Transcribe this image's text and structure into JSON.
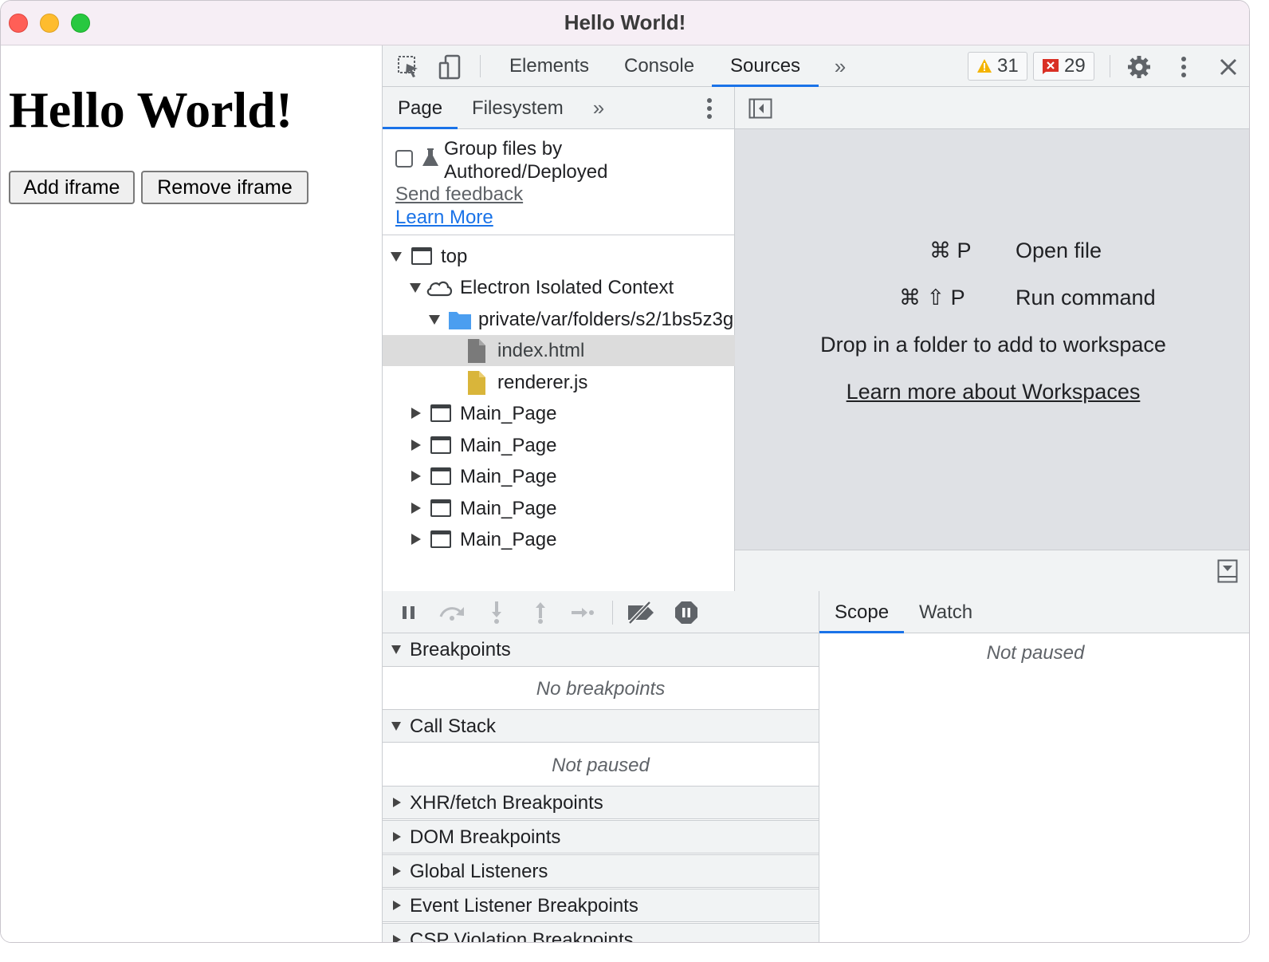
{
  "window": {
    "title": "Hello World!"
  },
  "page": {
    "heading": "Hello World!",
    "add_button": "Add iframe",
    "remove_button": "Remove iframe"
  },
  "devtools": {
    "tabs": [
      "Elements",
      "Console",
      "Sources"
    ],
    "active_tab": "Sources",
    "warnings_count": "31",
    "errors_count": "29",
    "navigator": {
      "tabs": [
        "Page",
        "Filesystem"
      ],
      "group_label_line1": "Group files by",
      "group_label_line2": "Authored/Deployed",
      "send_feedback": "Send feedback",
      "learn_more": "Learn More",
      "tree": {
        "top": "top",
        "context": "Electron Isolated Context",
        "folder": "private/var/folders/s2/1bs5z3g",
        "file1": "index.html",
        "file2": "renderer.js",
        "frames": [
          "Main_Page",
          "Main_Page",
          "Main_Page",
          "Main_Page",
          "Main_Page"
        ]
      }
    },
    "editor": {
      "open_file_keys": "⌘ P",
      "open_file_label": "Open file",
      "run_command_keys": "⌘ ⇧ P",
      "run_command_label": "Run command",
      "drop_text": "Drop in a folder to add to workspace",
      "workspaces_link": "Learn more about Workspaces"
    },
    "debugger": {
      "sections": {
        "breakpoints": "Breakpoints",
        "no_breakpoints": "No breakpoints",
        "call_stack": "Call Stack",
        "not_paused": "Not paused",
        "xhr": "XHR/fetch Breakpoints",
        "dom": "DOM Breakpoints",
        "global": "Global Listeners",
        "event": "Event Listener Breakpoints",
        "csp": "CSP Violation Breakpoints"
      }
    },
    "scope": {
      "tabs": [
        "Scope",
        "Watch"
      ],
      "status": "Not paused"
    }
  },
  "colors": {
    "accent": "#1a73e8",
    "close": "#ff5f57",
    "minimize": "#febc2e",
    "maximize": "#28c840",
    "warning": "#f4b400",
    "error": "#d93025"
  }
}
